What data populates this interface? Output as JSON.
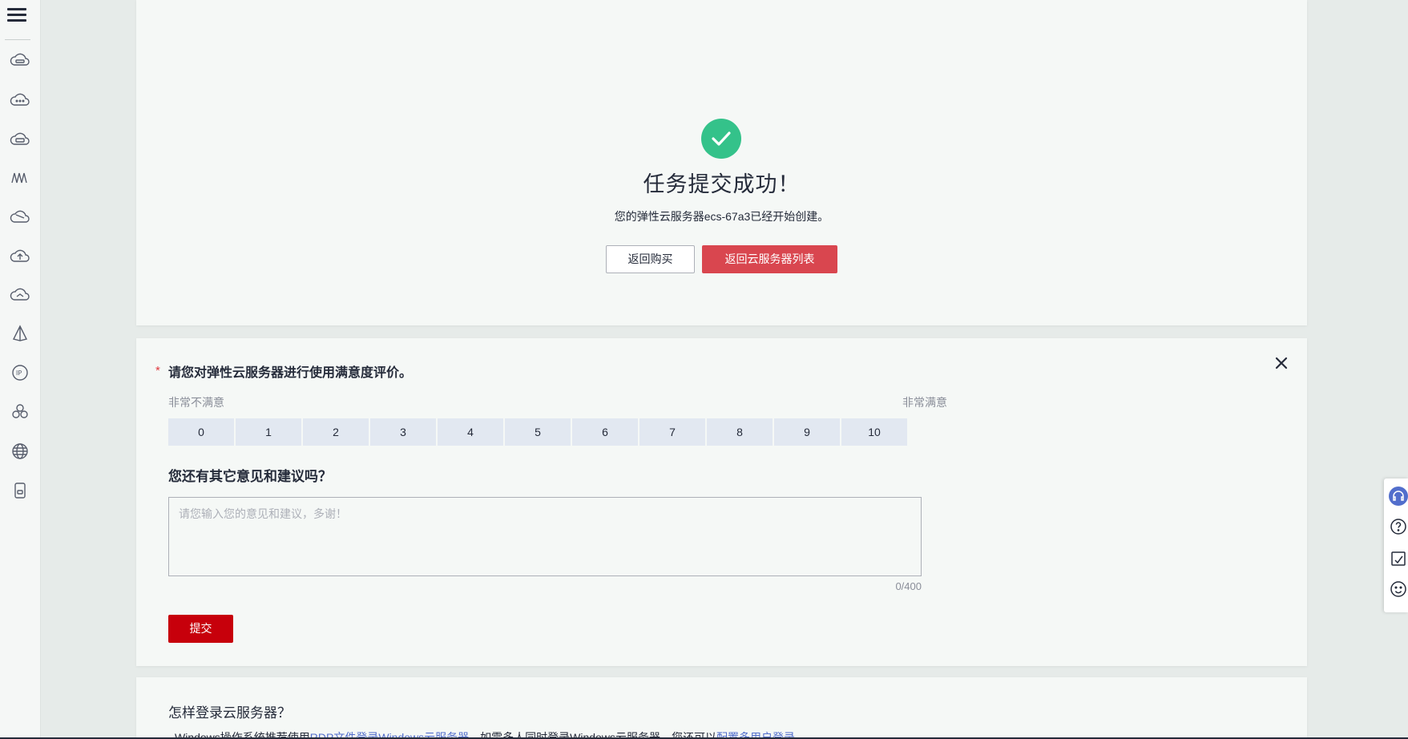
{
  "nav": {
    "menu_icon": "hamburger-icon",
    "items": [
      {
        "icon": "cloud-server-icon"
      },
      {
        "icon": "cloud-dots-icon"
      },
      {
        "icon": "cloud-ssd-icon"
      },
      {
        "icon": "waves-icon"
      },
      {
        "icon": "cloud-layers-icon"
      },
      {
        "icon": "cloud-upload-icon"
      },
      {
        "icon": "cloud-sync-icon"
      },
      {
        "icon": "prism-icon"
      },
      {
        "icon": "ip-icon"
      },
      {
        "icon": "cluster-icon"
      },
      {
        "icon": "globe-icon"
      },
      {
        "icon": "storage-icon"
      }
    ]
  },
  "success": {
    "title": "任务提交成功！",
    "description": "您的弹性云服务器ecs-67a3已经开始创建。",
    "back_buy_label": "返回购买",
    "back_list_label": "返回云服务器列表",
    "accent_color": "#34c28a"
  },
  "survey": {
    "required_mark": "*",
    "question": "请您对弹性云服务器进行使用满意度评价。",
    "low_label": "非常不满意",
    "high_label": "非常满意",
    "scale": [
      "0",
      "1",
      "2",
      "3",
      "4",
      "5",
      "6",
      "7",
      "8",
      "9",
      "10"
    ],
    "suggestion_question": "您还有其它意见和建议吗？",
    "feedback_placeholder": "请您输入您的意见和建议，多谢！",
    "feedback_value": "",
    "counter": "0/400",
    "submit_label": "提交",
    "submit_color": "#c7000b"
  },
  "login_help": {
    "title": "怎样登录云服务器？",
    "text_prefix": "Windows操作系统推荐使用",
    "link1": "RDP文件登录Windows云服务器",
    "text_mid": "。如需多人同时登录Windows云服务器，您还可以",
    "link2": "配置多用户登录"
  },
  "float_bar": {
    "items": [
      "headset-icon",
      "help-icon",
      "edit-note-icon",
      "feedback-face-icon"
    ]
  }
}
